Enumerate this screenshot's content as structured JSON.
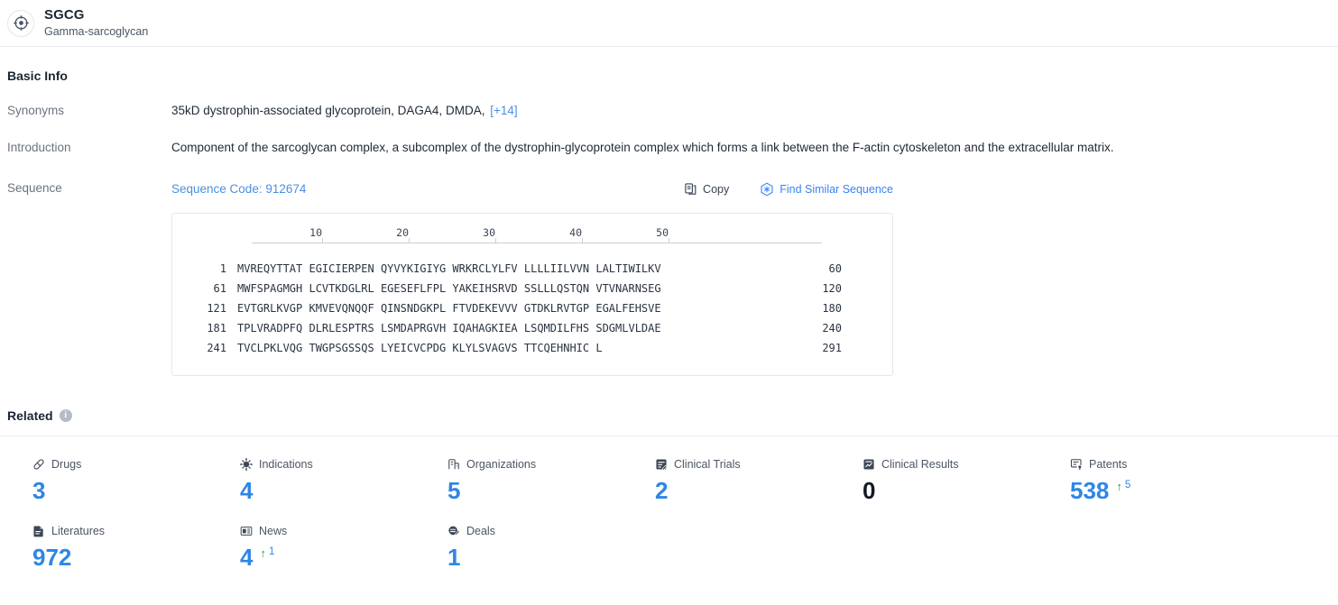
{
  "header": {
    "icon": "target-crosshair-icon",
    "symbol": "SGCG",
    "full_name": "Gamma-sarcoglycan"
  },
  "basic_info": {
    "title": "Basic Info",
    "synonyms_label": "Synonyms",
    "synonyms": [
      "35kD dystrophin-associated glycoprotein,",
      "DAGA4,",
      "DMDA,"
    ],
    "synonyms_more": "[+14]",
    "introduction_label": "Introduction",
    "introduction": "Component of the sarcoglycan complex, a subcomplex of the dystrophin-glycoprotein complex which forms a link between the F-actin cytoskeleton and the extracellular matrix.",
    "sequence_label": "Sequence"
  },
  "sequence": {
    "code_label": "Sequence Code: 912674",
    "copy_label": "Copy",
    "copy_icon": "copy-icon",
    "find_similar_label": "Find Similar Sequence",
    "find_similar_icon": "find-similar-sequence-icon",
    "ruler_ticks": [
      10,
      20,
      30,
      40,
      50
    ],
    "lines": [
      {
        "start": "1",
        "residues": "MVREQYTTAT EGICIERPEN QYVYKIGIYG WRKRCLYLFV LLLLIILVVN LALTIWILKV",
        "end": "60"
      },
      {
        "start": "61",
        "residues": "MWFSPAGMGH LCVTKDGLRL EGESEFLFPL YAKEIHSRVD SSLLLQSTQN VTVNARNSEG",
        "end": "120"
      },
      {
        "start": "121",
        "residues": "EVTGRLKVGP KMVEVQNQQF QINSNDGKPL FTVDEKEVVV GTDKLRVTGP EGALFEHSVE",
        "end": "180"
      },
      {
        "start": "181",
        "residues": "TPLVRADPFQ DLRLESPTRS LSMDAPRGVH IQAHAGKIEA LSQMDILFHS SDGMLVLDAE",
        "end": "240"
      },
      {
        "start": "241",
        "residues": "TVCLPKLVQG TWGPSGSSQS LYEICVCPDG KLYLSVAGVS TTCQEHNHIC L",
        "end": "291"
      }
    ]
  },
  "related": {
    "title": "Related",
    "info_icon": "info-icon",
    "cards": [
      {
        "icon": "drugs-pill-icon",
        "label": "Drugs",
        "value": "3",
        "delta": null,
        "delta_arrow": ""
      },
      {
        "icon": "indications-virus-icon",
        "label": "Indications",
        "value": "4",
        "delta": null,
        "delta_arrow": ""
      },
      {
        "icon": "organizations-icon",
        "label": "Organizations",
        "value": "5",
        "delta": null,
        "delta_arrow": ""
      },
      {
        "icon": "clinical-trials-icon",
        "label": "Clinical Trials",
        "value": "2",
        "delta": null,
        "delta_arrow": ""
      },
      {
        "icon": "clinical-results-icon",
        "label": "Clinical Results",
        "value": "0",
        "delta": null,
        "delta_arrow": ""
      },
      {
        "icon": "patents-icon",
        "label": "Patents",
        "value": "538",
        "delta": "5",
        "delta_arrow": "↑"
      },
      {
        "icon": "literatures-icon",
        "label": "Literatures",
        "value": "972",
        "delta": null,
        "delta_arrow": ""
      },
      {
        "icon": "news-icon",
        "label": "News",
        "value": "4",
        "delta": "1",
        "delta_arrow": "↑"
      },
      {
        "icon": "deals-icon",
        "label": "Deals",
        "value": "1",
        "delta": null,
        "delta_arrow": ""
      }
    ]
  },
  "colors": {
    "link_blue": "#4a90e2",
    "value_blue": "#2e86e6",
    "delta_green": "#2ca02c",
    "label_gray": "#6b7280"
  }
}
